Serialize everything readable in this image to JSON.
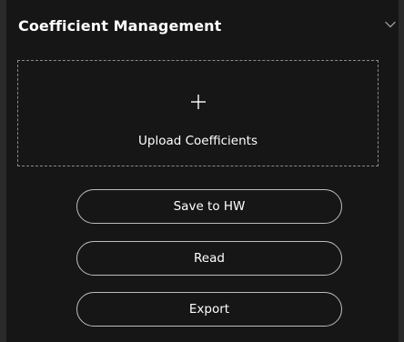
{
  "panel": {
    "title": "Coefficient Management",
    "toggle_icon": "chevron-down-icon"
  },
  "upload": {
    "icon": "plus-icon",
    "label": "Upload Coefficients"
  },
  "actions": {
    "save_label": "Save to HW",
    "read_label": "Read",
    "export_label": "Export"
  },
  "colors": {
    "background": "#161616",
    "outer_background": "#2a2a2a",
    "text": "#ffffff",
    "button_border": "#bdbdbd",
    "dashed_border": "#8a8a8a"
  }
}
